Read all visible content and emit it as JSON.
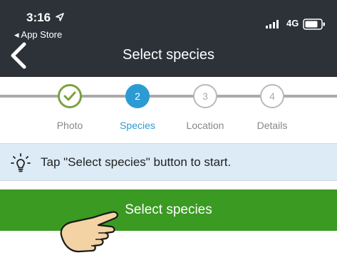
{
  "status_bar": {
    "time": "3:16",
    "back_app_label": "◂ App Store",
    "network": "4G"
  },
  "nav": {
    "title": "Select species",
    "back_icon": "chevron-left-icon"
  },
  "stepper": {
    "steps": [
      {
        "number": "1",
        "label": "Photo",
        "state": "done"
      },
      {
        "number": "2",
        "label": "Species",
        "state": "current"
      },
      {
        "number": "3",
        "label": "Location",
        "state": "pending"
      },
      {
        "number": "4",
        "label": "Details",
        "state": "pending"
      }
    ],
    "colors": {
      "done": "#7da143",
      "current": "#2c9bd4",
      "pending": "#aaaaaa"
    }
  },
  "hint": {
    "icon": "lightbulb-icon",
    "text": "Tap \"Select species\" button to start."
  },
  "primary_button": {
    "label": "Select species",
    "color": "#3a9a22"
  },
  "overlay": {
    "icon": "pointing-hand-icon"
  }
}
